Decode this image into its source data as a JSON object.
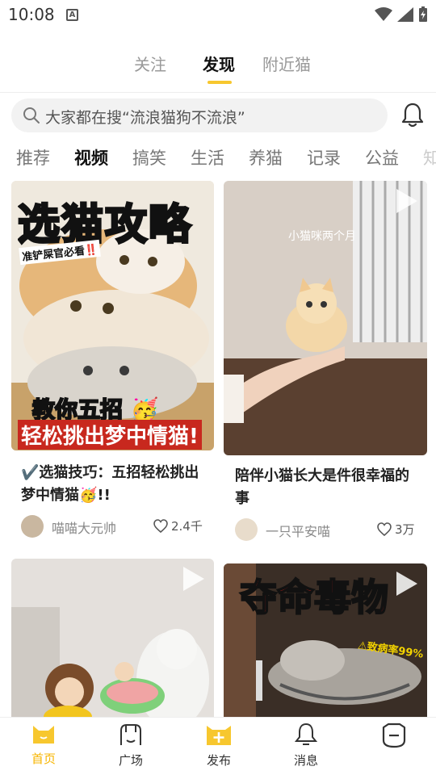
{
  "status_bar": {
    "time": "10:08",
    "notif_letter": "A"
  },
  "top_tabs": [
    {
      "label": "关注"
    },
    {
      "label": "发现"
    },
    {
      "label": "附近猫"
    }
  ],
  "search": {
    "placeholder": "大家都在搜“流浪猫狗不流浪”"
  },
  "categories": [
    {
      "label": "推荐"
    },
    {
      "label": "视频"
    },
    {
      "label": "搞笑"
    },
    {
      "label": "生活"
    },
    {
      "label": "养猫"
    },
    {
      "label": "记录"
    },
    {
      "label": "公益"
    },
    {
      "label": "知"
    }
  ],
  "feed": [
    {
      "title": "✔️选猫技巧：五招轻松挑出梦中情猫🥳!!",
      "thumb_headline": "选猫攻略",
      "thumb_small": "准铲屎官必看‼️",
      "thumb_bottom1": "教你五招 🥳",
      "thumb_bottom2": "轻松挑出梦中情猫!",
      "author": "喵喵大元帅",
      "likes": "2.4千"
    },
    {
      "title": "陪伴小猫长大是件很幸福的事",
      "thumb_caption": "小猫咪两个月",
      "author": "一只平安喵",
      "likes": "3万"
    },
    {
      "title": "",
      "author": "",
      "likes": ""
    },
    {
      "title": "",
      "thumb_headline": "夺命毒物",
      "thumb_small": "⚠致病率99%",
      "author": "",
      "likes": ""
    }
  ],
  "bottom_nav": [
    {
      "label": "首页",
      "icon": "home-cat-icon"
    },
    {
      "label": "广场",
      "icon": "square-icon"
    },
    {
      "label": "发布",
      "icon": "publish-plus-icon"
    },
    {
      "label": "消息",
      "icon": "message-icon"
    },
    {
      "label": "",
      "icon": "profile-icon"
    }
  ],
  "colors": {
    "accent": "#F7C72E",
    "active_nav": "#F7B500"
  }
}
